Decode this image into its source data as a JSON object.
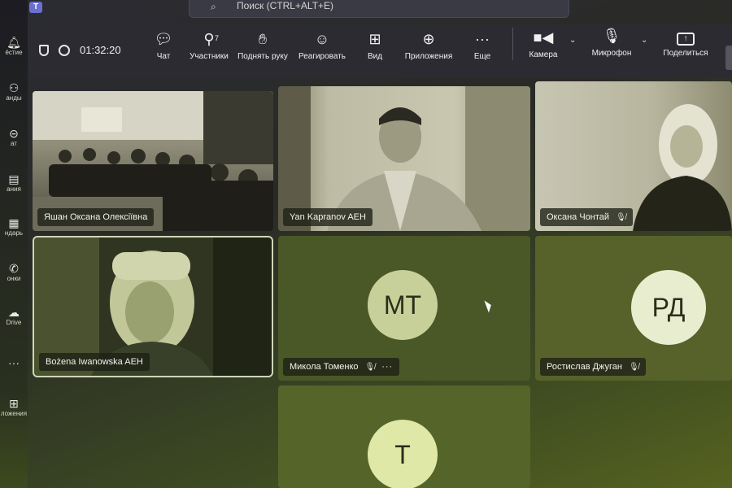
{
  "app": {
    "logo_letter": "T"
  },
  "search": {
    "placeholder": "Поиск (CTRL+ALT+E)"
  },
  "rail": {
    "items": [
      {
        "label": "ёстие",
        "icon": "bell-icon"
      },
      {
        "label": "анды",
        "icon": "teams-icon"
      },
      {
        "label": "ат",
        "icon": "chat-icon"
      },
      {
        "label": "ания",
        "icon": "assignments-icon"
      },
      {
        "label": "ндарь",
        "icon": "calendar-icon"
      },
      {
        "label": "онки",
        "icon": "phone-icon"
      },
      {
        "label": "Drive",
        "icon": "cloud-icon"
      },
      {
        "label": "ложения",
        "icon": "add-apps-icon"
      }
    ]
  },
  "toolbar": {
    "timer": "01:32:20",
    "chat": "Чат",
    "participants": "Участники",
    "participants_count": "7",
    "raise_hand": "Поднять руку",
    "react": "Реагировать",
    "view": "Вид",
    "apps": "Приложения",
    "more": "Еще",
    "camera": "Камера",
    "mic": "Микрофон",
    "share": "Поделиться"
  },
  "participants": [
    {
      "name": "Яшан Оксана Олексіївна",
      "muted": false,
      "type": "video"
    },
    {
      "name": "Yan Kapranov AEH",
      "muted": false,
      "type": "video"
    },
    {
      "name": "Оксана Чонтай",
      "muted": true,
      "type": "video"
    },
    {
      "name": "Bożena Iwanowska AEH",
      "muted": false,
      "type": "video"
    },
    {
      "name": "Микола Томенко",
      "initials": "МТ",
      "muted": true,
      "type": "avatar"
    },
    {
      "name": "Ростислав Джуган",
      "initials": "РД",
      "muted": true,
      "type": "avatar"
    },
    {
      "name": "",
      "initials": "Т",
      "muted": false,
      "type": "avatar"
    }
  ],
  "colors": {
    "tile": "#4a5727",
    "avatar": "#c8d09a",
    "toolbar": "#2b2b31"
  }
}
